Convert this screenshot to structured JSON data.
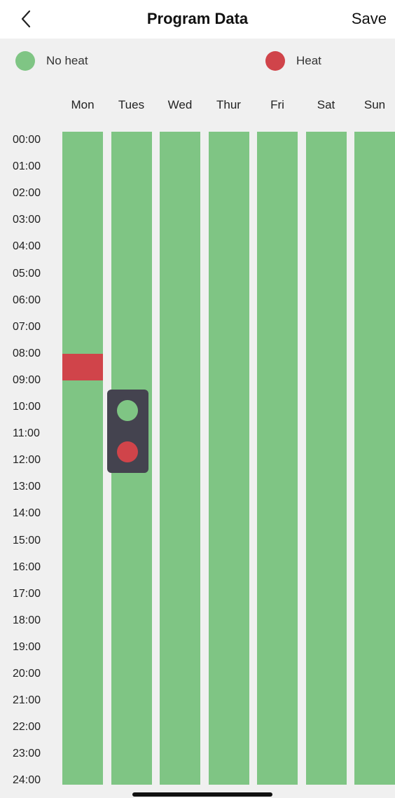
{
  "header": {
    "title": "Program Data",
    "save_label": "Save",
    "back_icon": "chevron-left-icon"
  },
  "legend": [
    {
      "label": "No heat",
      "color": "#7fc584"
    },
    {
      "label": "Heat",
      "color": "#d0444a"
    }
  ],
  "colors": {
    "no_heat": "#7fc584",
    "heat": "#d0444a",
    "popup_bg": "#44434f"
  },
  "days": [
    "Mon",
    "Tues",
    "Wed",
    "Thur",
    "Fri",
    "Sat",
    "Sun"
  ],
  "times": [
    "00:00",
    "01:00",
    "02:00",
    "03:00",
    "04:00",
    "05:00",
    "06:00",
    "07:00",
    "08:00",
    "09:00",
    "10:00",
    "11:00",
    "12:00",
    "13:00",
    "14:00",
    "15:00",
    "16:00",
    "17:00",
    "18:00",
    "19:00",
    "20:00",
    "21:00",
    "22:00",
    "23:00",
    "24:00"
  ],
  "schedule": {
    "Mon": [
      {
        "state": "heat",
        "start": "08:00",
        "end": "09:00"
      }
    ],
    "Tues": [],
    "Wed": [],
    "Thur": [],
    "Fri": [],
    "Sat": [],
    "Sun": []
  },
  "popup": {
    "day": "Tues",
    "options": [
      "no_heat",
      "heat"
    ]
  }
}
